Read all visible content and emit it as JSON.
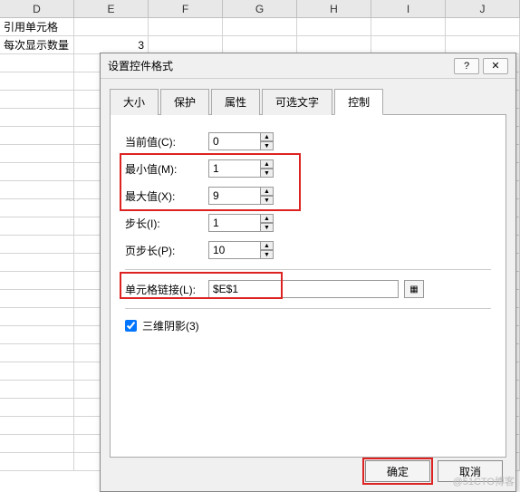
{
  "columns": [
    "D",
    "E",
    "F",
    "G",
    "H",
    "I",
    "J"
  ],
  "cells": {
    "d1": "引用单元格",
    "d2": "每次显示数量",
    "e2": "3"
  },
  "dialog": {
    "title": "设置控件格式",
    "help_label": "?",
    "close_label": "✕",
    "tabs": [
      "大小",
      "保护",
      "属性",
      "可选文字",
      "控制"
    ],
    "active_tab": 4,
    "fields": {
      "current_label": "当前值(C):",
      "current_value": "0",
      "min_label": "最小值(M):",
      "min_value": "1",
      "max_label": "最大值(X):",
      "max_value": "9",
      "step_label": "步长(I):",
      "step_value": "1",
      "pagestep_label": "页步长(P):",
      "pagestep_value": "10",
      "link_label": "单元格链接(L):",
      "link_value": "$E$1"
    },
    "shadow_label": "三维阴影(3)",
    "shadow_checked": true,
    "ok_label": "确定",
    "cancel_label": "取消"
  },
  "watermark": "@51CTO博客"
}
